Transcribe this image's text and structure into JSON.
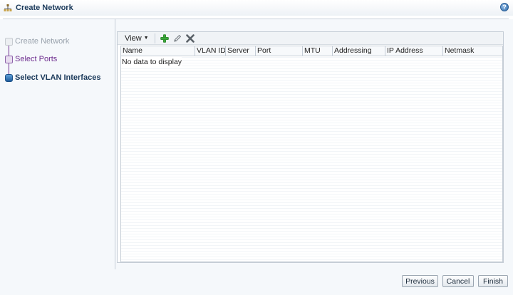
{
  "window": {
    "title": "Create Network",
    "help_glyph": "?"
  },
  "train": {
    "steps": [
      {
        "label": "Create Network",
        "state": "visited"
      },
      {
        "label": "Select Ports",
        "state": "visited"
      },
      {
        "label": "Select VLAN Interfaces",
        "state": "current"
      }
    ]
  },
  "toolbar": {
    "view_label": "View",
    "view_caret": "▼",
    "add_icon": "add-icon",
    "edit_icon": "pencil-icon",
    "delete_icon": "delete-icon"
  },
  "table": {
    "columns": [
      "Name",
      "VLAN ID",
      "Server",
      "Port",
      "MTU",
      "Addressing",
      "IP Address",
      "Netmask"
    ],
    "empty_text": "No data to display"
  },
  "buttons": {
    "previous": "Previous",
    "cancel": "Cancel",
    "finish": "Finish"
  },
  "colors": {
    "accent_train": "#6e2e8f",
    "current_step": "#1b3a5b",
    "add_green": "#3aa83a",
    "delete_gray": "#5a6168"
  }
}
